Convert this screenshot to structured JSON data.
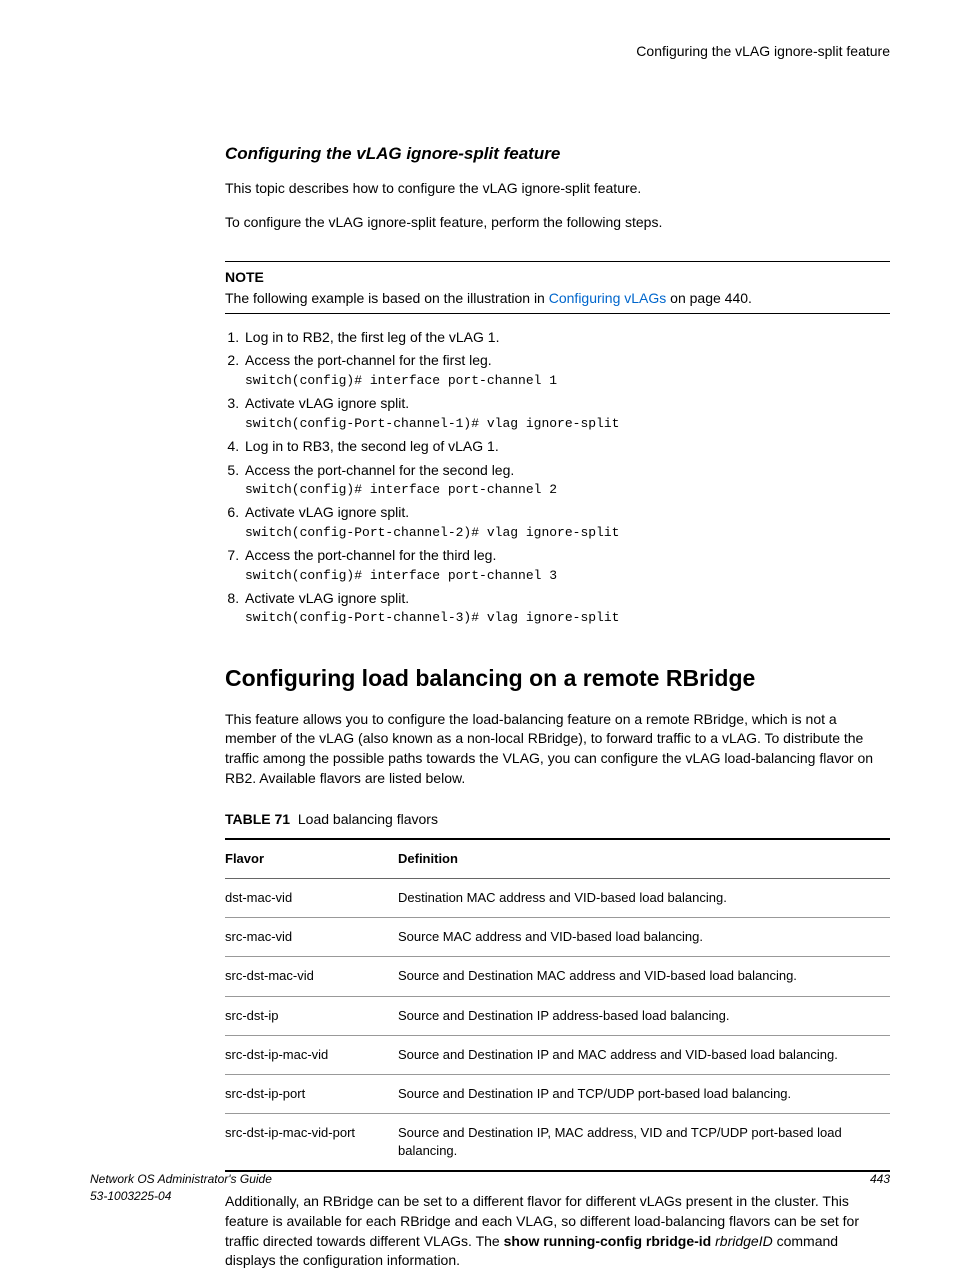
{
  "running_head": "Configuring the vLAG ignore-split feature",
  "section_title": "Configuring the vLAG ignore-split feature",
  "intro1": "This topic describes how to configure the vLAG ignore-split feature.",
  "intro2": "To configure the vLAG ignore-split feature, perform the following steps.",
  "note": {
    "label": "NOTE",
    "prefix": "The following example is based on the illustration in ",
    "link_text": "Configuring vLAGs",
    "suffix": " on page 440."
  },
  "steps": [
    {
      "text": "Log in to RB2, the first leg of the vLAG 1."
    },
    {
      "text": "Access the port-channel for the first leg.",
      "cmd": "switch(config)# interface port-channel 1"
    },
    {
      "text": "Activate vLAG ignore split.",
      "cmd": "switch(config-Port-channel-1)# vlag ignore-split"
    },
    {
      "text": "Log in to RB3, the second leg of vLAG 1."
    },
    {
      "text": "Access the port-channel for the second leg.",
      "cmd": "switch(config)# interface port-channel 2"
    },
    {
      "text": "Activate vLAG ignore split.",
      "cmd": "switch(config-Port-channel-2)# vlag ignore-split"
    },
    {
      "text": "Access the port-channel for the third leg.",
      "cmd": "switch(config)# interface port-channel 3"
    },
    {
      "text": "Activate vLAG ignore split.",
      "cmd": "switch(config-Port-channel-3)# vlag ignore-split"
    }
  ],
  "h2": "Configuring load balancing on a remote RBridge",
  "h2_body": "This feature allows you to configure the load-balancing feature on a remote RBridge, which is not a member of the vLAG (also known as a non-local RBridge), to forward traffic to a vLAG. To distribute the traffic among the possible paths towards the VLAG, you can configure the vLAG load-balancing flavor on RB2. Available flavors are listed below.",
  "table": {
    "label": "TABLE 71",
    "title": "Load balancing flavors",
    "headers": {
      "col1": "Flavor",
      "col2": "Definition"
    },
    "rows": [
      {
        "flavor": "dst-mac-vid",
        "def": "Destination MAC address and VID-based load balancing."
      },
      {
        "flavor": "src-mac-vid",
        "def": "Source MAC address and VID-based load balancing."
      },
      {
        "flavor": "src-dst-mac-vid",
        "def": "Source and Destination MAC address and VID-based load balancing."
      },
      {
        "flavor": "src-dst-ip",
        "def": "Source and Destination IP address-based load balancing."
      },
      {
        "flavor": "src-dst-ip-mac-vid",
        "def": "Source and Destination IP and MAC address and VID-based load balancing."
      },
      {
        "flavor": "src-dst-ip-port",
        "def": "Source and Destination IP and TCP/UDP port-based load balancing."
      },
      {
        "flavor": "src-dst-ip-mac-vid-port",
        "def": "Source and Destination IP, MAC address, VID and TCP/UDP port-based load balancing."
      }
    ]
  },
  "after_table": {
    "p1a": "Additionally, an RBridge can be set to a different flavor for different vLAGs present in the cluster. This feature is available for each RBridge and each VLAG, so different load-balancing flavors can be set for traffic directed towards different VLAGs. The ",
    "bold": "show running-config rbridge-id",
    "ital": " rbridgeID",
    "p1b": " command displays the configuration information."
  },
  "footer": {
    "line1": "Network OS Administrator's Guide",
    "line2": "53-1003225-04",
    "page": "443"
  }
}
